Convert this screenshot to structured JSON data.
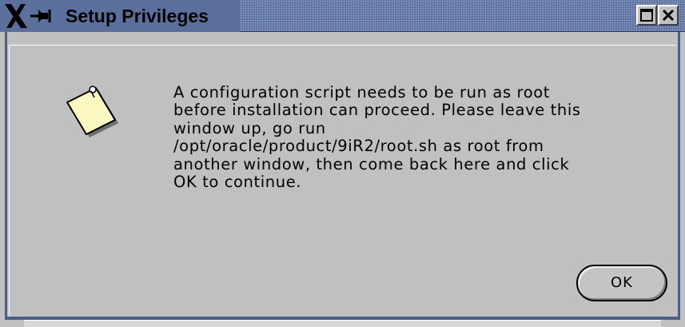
{
  "window": {
    "title": "Setup Privileges",
    "title_bar_color": "#5a6f9c",
    "buttons": [
      "maximize",
      "close"
    ]
  },
  "dialog": {
    "icon": "note-icon",
    "message_lines": [
      "A configuration script needs to be run as root",
      "before installation can proceed. Please leave this",
      "window up, go run",
      "/opt/oracle/product/9iR2/root.sh as root from",
      "another window, then come back here and click",
      "OK to continue."
    ],
    "ok_label": "OK"
  }
}
